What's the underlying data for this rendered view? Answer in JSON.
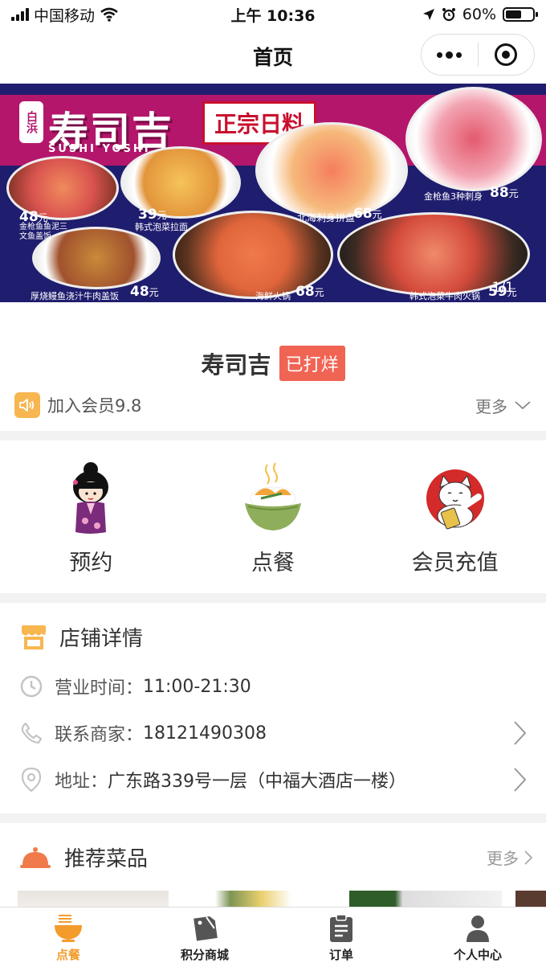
{
  "status_bar": {
    "carrier": "中国移动",
    "time": "上午 10:36",
    "battery_percent": "60%",
    "battery_level": 0.6
  },
  "nav": {
    "title": "首页",
    "more_icon": "ellipsis-icon",
    "close_icon": "target-icon"
  },
  "banner": {
    "brand_badge": "白浜",
    "brand_name": "寿司吉",
    "brand_name_en": "SUSHI YOSHI",
    "tag": "正宗日料",
    "prices": [
      {
        "dish": "金枪鱼鱼泥三文鱼盖饭",
        "price": "48",
        "unit": "元"
      },
      {
        "dish": "韩式泡菜拉面",
        "price": "39",
        "unit": "元"
      },
      {
        "dish": "北海刺身拼盘",
        "price": "68",
        "unit": "元"
      },
      {
        "dish": "金枪鱼3种刺身",
        "price": "88",
        "unit": "元"
      },
      {
        "dish": "厚烧鳗鱼浇汁牛肉盖饭",
        "price": "48",
        "unit": "元"
      },
      {
        "dish": "海鲜火锅",
        "price": "68",
        "unit": "元"
      },
      {
        "dish": "韩式泡菜牛肉火锅",
        "price": "59",
        "unit": "元"
      }
    ],
    "counter": "1/1"
  },
  "store": {
    "name": "寿司吉",
    "status_badge": "已打烊",
    "notice": "加入会员9.8",
    "more_label": "更多"
  },
  "actions": [
    {
      "label": "预约",
      "icon": "kokeshi-doll-icon"
    },
    {
      "label": "点餐",
      "icon": "rice-bowl-icon"
    },
    {
      "label": "会员充值",
      "icon": "lucky-cat-icon"
    }
  ],
  "details": {
    "title": "店铺详情",
    "hours_label": "营业时间：",
    "hours_value": "11:00-21:30",
    "phone_label": "联系商家：",
    "phone_value": "18121490308",
    "address_label": "地址：",
    "address_value": "广东路339号一层（中福大酒店一楼）"
  },
  "recommend": {
    "title": "推荐菜品",
    "more_label": "更多"
  },
  "tabs": [
    {
      "label": "点餐",
      "icon": "noodle-bowl-icon",
      "active": true
    },
    {
      "label": "积分商城",
      "icon": "tag-icon",
      "active": false
    },
    {
      "label": "订单",
      "icon": "clipboard-icon",
      "active": false
    },
    {
      "label": "个人中心",
      "icon": "user-icon",
      "active": false
    }
  ],
  "colors": {
    "accent": "#f39c2c",
    "badge": "#f06454",
    "banner_bg": "#1f1d6e",
    "banner_band": "#b4166b"
  }
}
